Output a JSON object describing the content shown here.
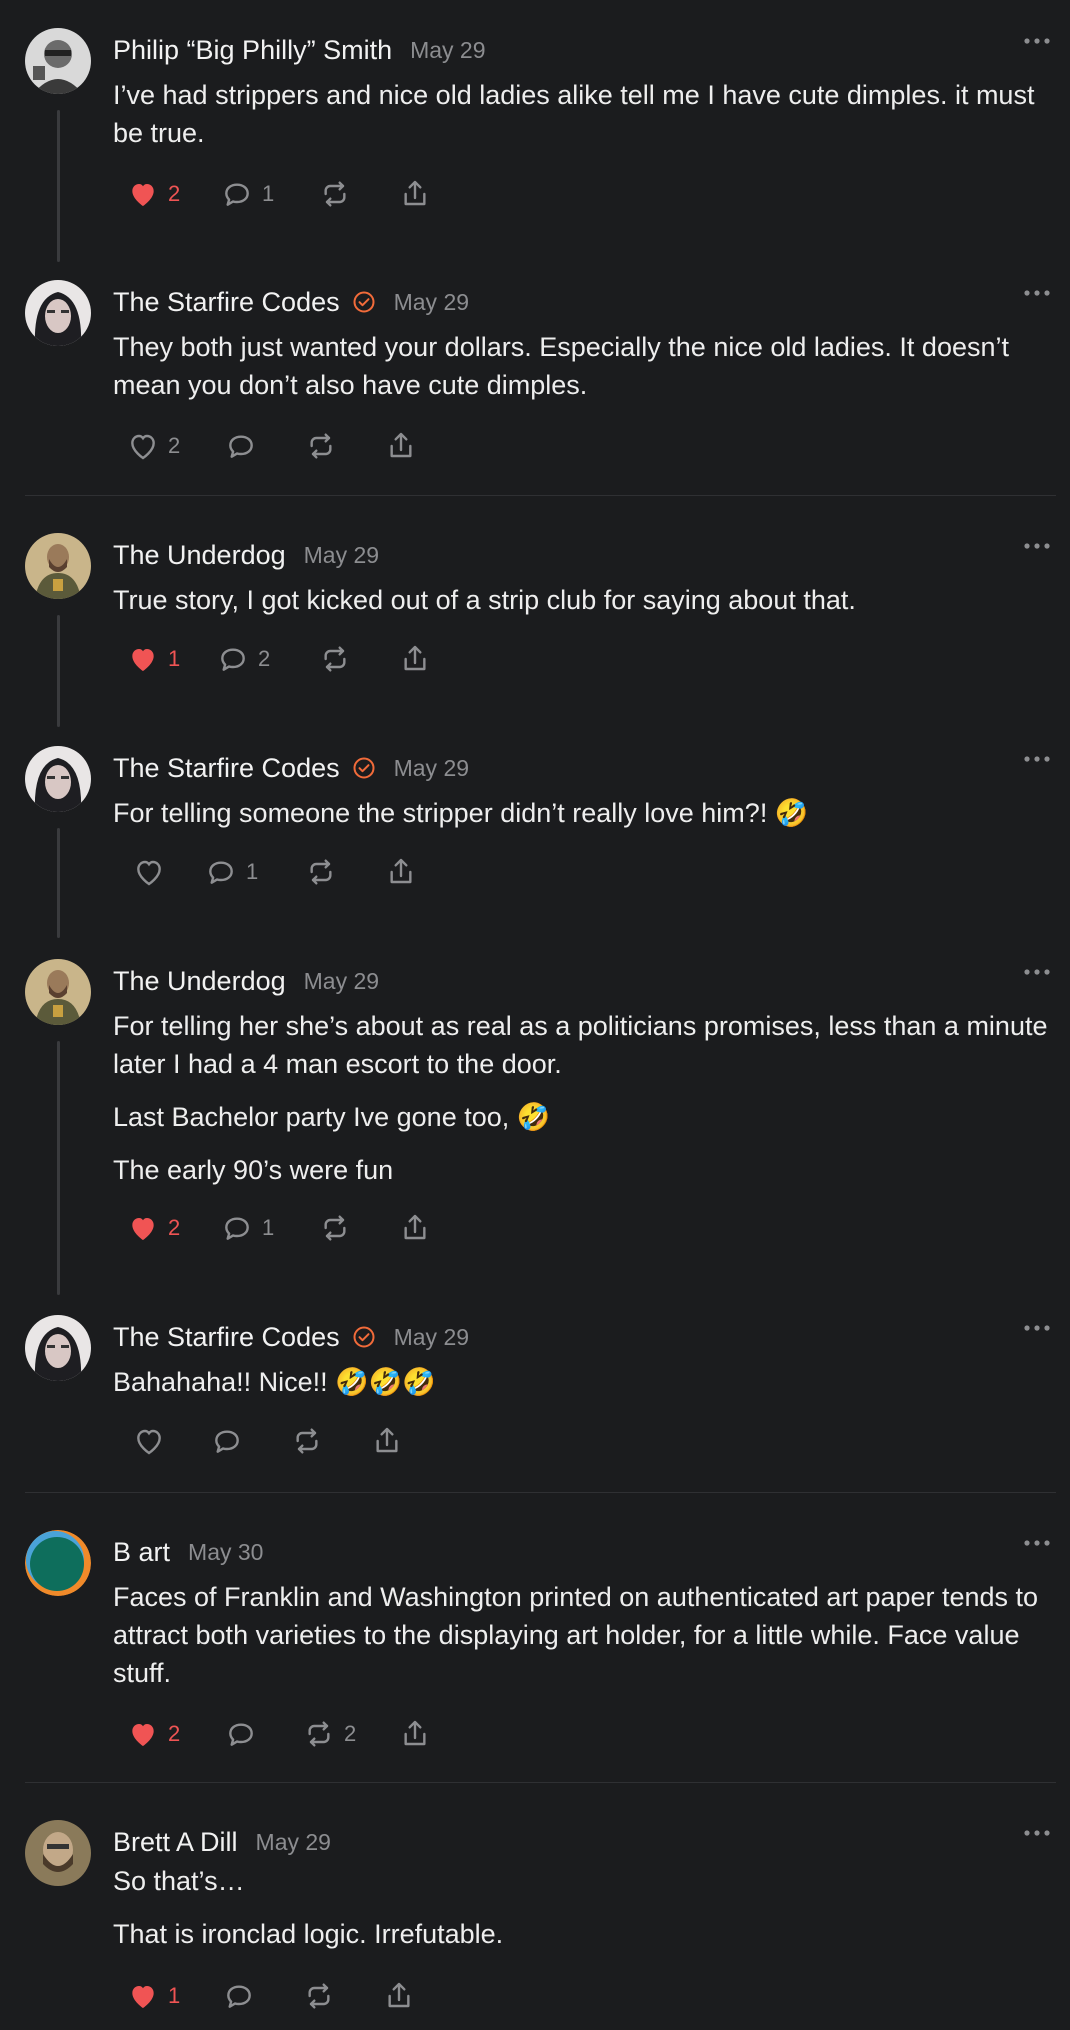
{
  "posts": [
    {
      "author": "Philip “Big Philly” Smith",
      "date": "May 29",
      "verified": false,
      "paragraphs": [
        "I’ve had strippers and nice old ladies alike tell me I have cute dimples. it must be true."
      ],
      "likes": "2",
      "liked": true,
      "replies": "1",
      "reposts": ""
    },
    {
      "author": "The Starfire Codes",
      "date": "May 29",
      "verified": true,
      "paragraphs": [
        "They both just wanted your dollars. Especially the nice old ladies. It doesn’t mean you don’t also have cute dimples."
      ],
      "likes": "2",
      "liked": false,
      "replies": "",
      "reposts": ""
    },
    {
      "author": "The Underdog",
      "date": "May 29",
      "verified": false,
      "paragraphs": [
        "True story, I got kicked out of a strip club for saying about that."
      ],
      "likes": "1",
      "liked": true,
      "replies": "2",
      "reposts": ""
    },
    {
      "author": "The Starfire Codes",
      "date": "May 29",
      "verified": true,
      "paragraphs": [
        "For telling someone the stripper didn’t really love him?! 🤣"
      ],
      "likes": "",
      "liked": false,
      "replies": "1",
      "reposts": ""
    },
    {
      "author": "The Underdog",
      "date": "May 29",
      "verified": false,
      "paragraphs": [
        "For telling her she’s about as real as a politicians promises, less than a minute later I had a 4 man escort to the door.",
        "Last Bachelor party Ive gone too, 🤣",
        "The early 90’s were fun"
      ],
      "likes": "2",
      "liked": true,
      "replies": "1",
      "reposts": ""
    },
    {
      "author": "The Starfire Codes",
      "date": "May 29",
      "verified": true,
      "paragraphs": [
        "Bahahaha!! Nice!! 🤣🤣🤣"
      ],
      "likes": "",
      "liked": false,
      "replies": "",
      "reposts": ""
    },
    {
      "author": "B art",
      "date": "May 30",
      "verified": false,
      "paragraphs": [
        "Faces of Franklin and Washington printed on authenticated art paper tends to attract both varieties to the displaying art holder, for a little while. Face value stuff."
      ],
      "likes": "2",
      "liked": true,
      "replies": "",
      "reposts": "2"
    },
    {
      "author": "Brett A Dill",
      "date": "May 29",
      "verified": false,
      "paragraphs": [
        "So that’s…",
        "That is ironclad logic. Irrefutable."
      ],
      "likes": "1",
      "liked": true,
      "replies": "",
      "reposts": ""
    }
  ],
  "colors": {
    "like": "#f05454",
    "verified": "#f26b3a",
    "muted": "#8d8e91",
    "background": "#1b1c1e"
  },
  "icons": {
    "like": "heart-icon",
    "reply": "comment-icon",
    "repost": "repost-icon",
    "share": "share-icon",
    "more": "more-icon",
    "verified": "verified-badge-icon"
  }
}
